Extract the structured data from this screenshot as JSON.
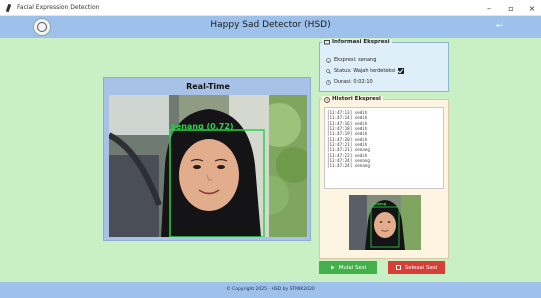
{
  "window": {
    "title": "Facial Expression Detection",
    "minimize": "–",
    "maximize": "▫",
    "close": "×"
  },
  "header": {
    "title": "Happy Sad Detector (HSD)",
    "exit_symbol": "↩"
  },
  "video": {
    "label": "Real-Time",
    "detection_label": "senang (0.72)",
    "box_color": "#2bd24a"
  },
  "info": {
    "title": "Informasi Ekspresi",
    "expression": "Ekspresi: senang",
    "status": "Status: Wajah terdeteksi",
    "duration": "Durasi: 0:02:10"
  },
  "history": {
    "title": "Histori Ekspresi",
    "entries": [
      "[11:47:13] sedih",
      "[11:47:14] sedih",
      "[11:47:16] sedih",
      "[11:47:18] sedih",
      "[11:47:19] sedih",
      "[11:47:20] sedih",
      "[11:47:21] sedih",
      "[11:47:21] senang",
      "[11:47:22] sedih",
      "[11:47:24] senang",
      "[11:47:24] senang"
    ],
    "thumb_label": "senang"
  },
  "buttons": {
    "start": "Mulai Sesi",
    "stop": "Selesai Sesi"
  },
  "footer": {
    "copyright": "© Copyright 2025 - HSD by STMIK2020"
  },
  "colors": {
    "background": "#c9efc4",
    "header": "#9ec1eb",
    "start_button": "#43b04a",
    "stop_button": "#d63e38"
  }
}
